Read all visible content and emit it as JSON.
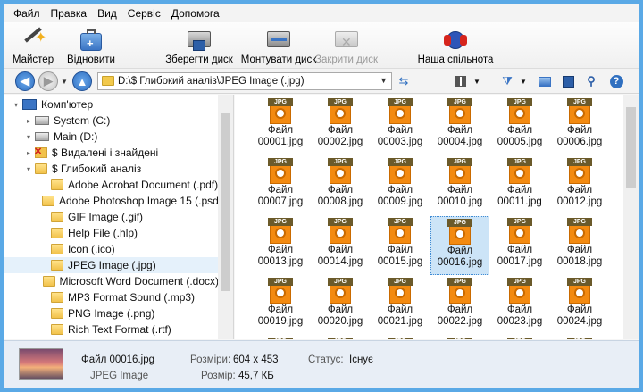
{
  "menu": [
    "Файл",
    "Правка",
    "Вид",
    "Сервіс",
    "Допомога"
  ],
  "toolbar": {
    "wizard": "Майстер",
    "restore": "Відновити",
    "save_disk": "Зберегти диск",
    "mount_disk": "Монтувати диск",
    "close_disk": "Закрити диск",
    "community": "Наша спільнота"
  },
  "address": {
    "path": "D:\\$ Глибокий аналіз\\JPEG Image (.jpg)"
  },
  "tree": [
    {
      "label": "Комп'ютер",
      "level": 0,
      "icon": "computer-icon",
      "toggle": "▾"
    },
    {
      "label": "System (C:)",
      "level": 1,
      "icon": "drive-icon",
      "toggle": "▸"
    },
    {
      "label": "Main (D:)",
      "level": 1,
      "icon": "drive-icon",
      "toggle": "▾"
    },
    {
      "label": "$ Видалені і знайдені",
      "level": 2,
      "icon": "deleted-folder-icon",
      "toggle": "▸"
    },
    {
      "label": "$ Глибокий аналіз",
      "level": 2,
      "icon": "folder-icon",
      "toggle": "▾"
    },
    {
      "label": "Adobe Acrobat Document (.pdf)",
      "level": 3,
      "icon": "folder-icon",
      "toggle": ""
    },
    {
      "label": "Adobe Photoshop Image 15 (.psd)",
      "level": 3,
      "icon": "folder-icon",
      "toggle": ""
    },
    {
      "label": "GIF Image (.gif)",
      "level": 3,
      "icon": "folder-icon",
      "toggle": ""
    },
    {
      "label": "Help File (.hlp)",
      "level": 3,
      "icon": "folder-icon",
      "toggle": ""
    },
    {
      "label": "Icon (.ico)",
      "level": 3,
      "icon": "folder-icon",
      "toggle": ""
    },
    {
      "label": "JPEG Image (.jpg)",
      "level": 3,
      "icon": "folder-icon",
      "toggle": "",
      "selected": true
    },
    {
      "label": "Microsoft Word Document (.docx)",
      "level": 3,
      "icon": "folder-icon",
      "toggle": ""
    },
    {
      "label": "MP3 Format Sound (.mp3)",
      "level": 3,
      "icon": "folder-icon",
      "toggle": ""
    },
    {
      "label": "PNG Image (.png)",
      "level": 3,
      "icon": "folder-icon",
      "toggle": ""
    },
    {
      "label": "Rich Text Format (.rtf)",
      "level": 3,
      "icon": "folder-icon",
      "toggle": ""
    }
  ],
  "files": {
    "badge": "JPG",
    "items": [
      [
        "Файл",
        "00001.jpg"
      ],
      [
        "Файл",
        "00002.jpg"
      ],
      [
        "Файл",
        "00003.jpg"
      ],
      [
        "Файл",
        "00004.jpg"
      ],
      [
        "Файл",
        "00005.jpg"
      ],
      [
        "Файл",
        "00006.jpg"
      ],
      [
        "Файл",
        "00007.jpg"
      ],
      [
        "Файл",
        "00008.jpg"
      ],
      [
        "Файл",
        "00009.jpg"
      ],
      [
        "Файл",
        "00010.jpg"
      ],
      [
        "Файл",
        "00011.jpg"
      ],
      [
        "Файл",
        "00012.jpg"
      ],
      [
        "Файл",
        "00013.jpg"
      ],
      [
        "Файл",
        "00014.jpg"
      ],
      [
        "Файл",
        "00015.jpg"
      ],
      [
        "Файл",
        "00016.jpg"
      ],
      [
        "Файл",
        "00017.jpg"
      ],
      [
        "Файл",
        "00018.jpg"
      ],
      [
        "Файл",
        "00019.jpg"
      ],
      [
        "Файл",
        "00020.jpg"
      ],
      [
        "Файл",
        "00021.jpg"
      ],
      [
        "Файл",
        "00022.jpg"
      ],
      [
        "Файл",
        "00023.jpg"
      ],
      [
        "Файл",
        "00024.jpg"
      ]
    ],
    "selected_index": 15
  },
  "status": {
    "file_name": "Файл 00016.jpg",
    "file_type": "JPEG Image",
    "dim_label": "Розміри:",
    "dim_value": "604 x 453",
    "size_label": "Розмір:",
    "size_value": "45,7 КБ",
    "state_label": "Статус:",
    "state_value": "Існує"
  }
}
